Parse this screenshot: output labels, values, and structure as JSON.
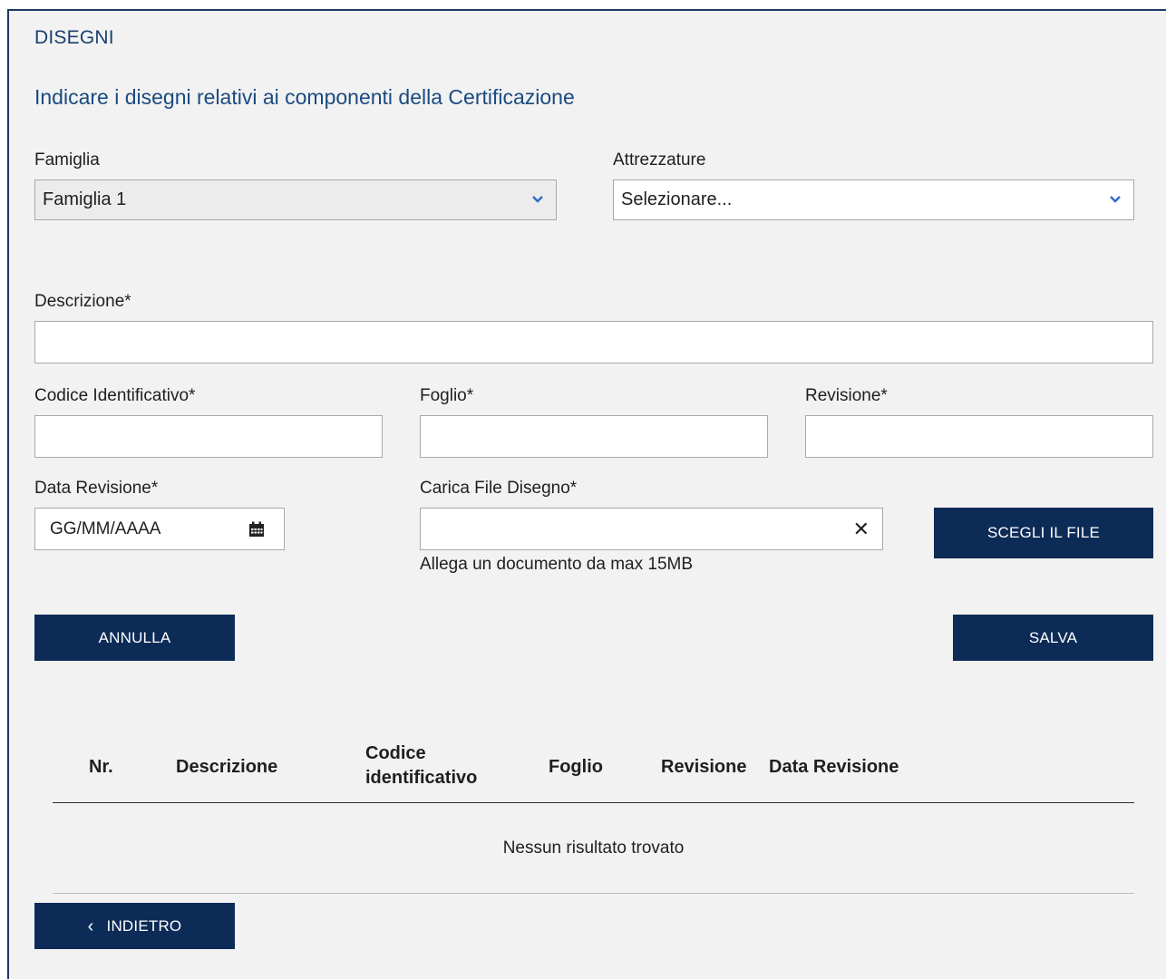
{
  "section_title": "DISEGNI",
  "subtitle": "Indicare i disegni relativi ai componenti della Certificazione",
  "famiglia": {
    "label": "Famiglia",
    "value": "Famiglia 1"
  },
  "attrezzature": {
    "label": "Attrezzature",
    "value": "Selezionare..."
  },
  "descrizione": {
    "label": "Descrizione*",
    "value": ""
  },
  "codice": {
    "label": "Codice Identificativo*",
    "value": ""
  },
  "foglio": {
    "label": "Foglio*",
    "value": ""
  },
  "revisione": {
    "label": "Revisione*",
    "value": ""
  },
  "data_revisione": {
    "label": "Data Revisione*",
    "placeholder": "GG/MM/AAAA"
  },
  "carica_file": {
    "label": "Carica File Disegno*",
    "hint": "Allega un documento da max 15MB",
    "button": "SCEGLI IL FILE",
    "clear_glyph": "✕"
  },
  "buttons": {
    "annulla": "ANNULLA",
    "salva": "SALVA",
    "indietro": "INDIETRO",
    "indietro_glyph": "‹"
  },
  "table": {
    "headers": {
      "nr": "Nr.",
      "descrizione": "Descrizione",
      "codice_line1": "Codice",
      "codice_line2": "identificativo",
      "foglio": "Foglio",
      "revisione": "Revisione",
      "data_revisione": "Data Revisione"
    },
    "empty_message": "Nessun risultato trovato"
  },
  "colors": {
    "primary": "#0d2b57",
    "heading": "#1b4a80",
    "chevron": "#2a6ad1"
  },
  "icons": {
    "select_chevron": "chevron-down-icon",
    "date": "calendar-icon",
    "clear": "close-icon",
    "back": "chevron-left-icon"
  }
}
